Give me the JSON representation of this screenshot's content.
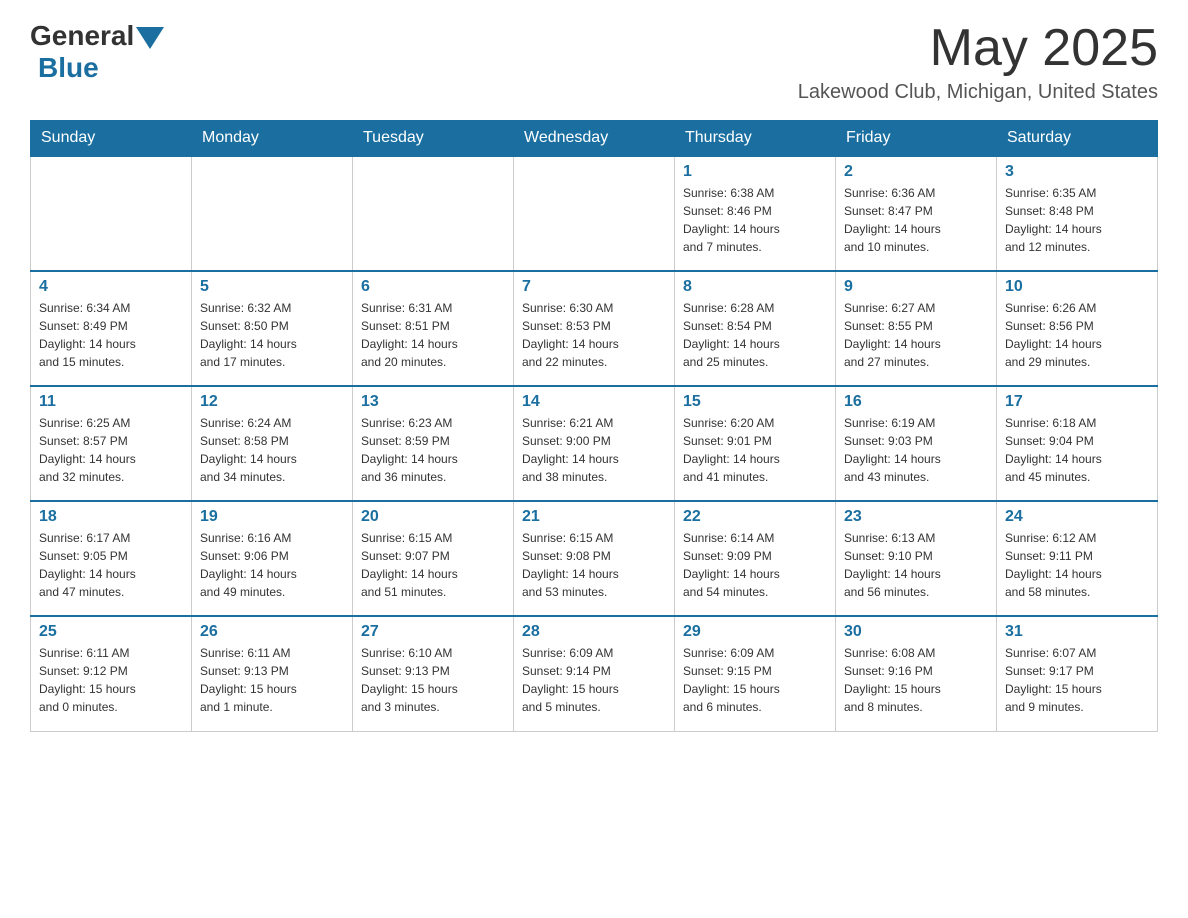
{
  "header": {
    "logo_general": "General",
    "logo_blue": "Blue",
    "month": "May 2025",
    "location": "Lakewood Club, Michigan, United States"
  },
  "days_of_week": [
    "Sunday",
    "Monday",
    "Tuesday",
    "Wednesday",
    "Thursday",
    "Friday",
    "Saturday"
  ],
  "weeks": [
    {
      "days": [
        {
          "number": "",
          "info": ""
        },
        {
          "number": "",
          "info": ""
        },
        {
          "number": "",
          "info": ""
        },
        {
          "number": "",
          "info": ""
        },
        {
          "number": "1",
          "info": "Sunrise: 6:38 AM\nSunset: 8:46 PM\nDaylight: 14 hours\nand 7 minutes."
        },
        {
          "number": "2",
          "info": "Sunrise: 6:36 AM\nSunset: 8:47 PM\nDaylight: 14 hours\nand 10 minutes."
        },
        {
          "number": "3",
          "info": "Sunrise: 6:35 AM\nSunset: 8:48 PM\nDaylight: 14 hours\nand 12 minutes."
        }
      ]
    },
    {
      "days": [
        {
          "number": "4",
          "info": "Sunrise: 6:34 AM\nSunset: 8:49 PM\nDaylight: 14 hours\nand 15 minutes."
        },
        {
          "number": "5",
          "info": "Sunrise: 6:32 AM\nSunset: 8:50 PM\nDaylight: 14 hours\nand 17 minutes."
        },
        {
          "number": "6",
          "info": "Sunrise: 6:31 AM\nSunset: 8:51 PM\nDaylight: 14 hours\nand 20 minutes."
        },
        {
          "number": "7",
          "info": "Sunrise: 6:30 AM\nSunset: 8:53 PM\nDaylight: 14 hours\nand 22 minutes."
        },
        {
          "number": "8",
          "info": "Sunrise: 6:28 AM\nSunset: 8:54 PM\nDaylight: 14 hours\nand 25 minutes."
        },
        {
          "number": "9",
          "info": "Sunrise: 6:27 AM\nSunset: 8:55 PM\nDaylight: 14 hours\nand 27 minutes."
        },
        {
          "number": "10",
          "info": "Sunrise: 6:26 AM\nSunset: 8:56 PM\nDaylight: 14 hours\nand 29 minutes."
        }
      ]
    },
    {
      "days": [
        {
          "number": "11",
          "info": "Sunrise: 6:25 AM\nSunset: 8:57 PM\nDaylight: 14 hours\nand 32 minutes."
        },
        {
          "number": "12",
          "info": "Sunrise: 6:24 AM\nSunset: 8:58 PM\nDaylight: 14 hours\nand 34 minutes."
        },
        {
          "number": "13",
          "info": "Sunrise: 6:23 AM\nSunset: 8:59 PM\nDaylight: 14 hours\nand 36 minutes."
        },
        {
          "number": "14",
          "info": "Sunrise: 6:21 AM\nSunset: 9:00 PM\nDaylight: 14 hours\nand 38 minutes."
        },
        {
          "number": "15",
          "info": "Sunrise: 6:20 AM\nSunset: 9:01 PM\nDaylight: 14 hours\nand 41 minutes."
        },
        {
          "number": "16",
          "info": "Sunrise: 6:19 AM\nSunset: 9:03 PM\nDaylight: 14 hours\nand 43 minutes."
        },
        {
          "number": "17",
          "info": "Sunrise: 6:18 AM\nSunset: 9:04 PM\nDaylight: 14 hours\nand 45 minutes."
        }
      ]
    },
    {
      "days": [
        {
          "number": "18",
          "info": "Sunrise: 6:17 AM\nSunset: 9:05 PM\nDaylight: 14 hours\nand 47 minutes."
        },
        {
          "number": "19",
          "info": "Sunrise: 6:16 AM\nSunset: 9:06 PM\nDaylight: 14 hours\nand 49 minutes."
        },
        {
          "number": "20",
          "info": "Sunrise: 6:15 AM\nSunset: 9:07 PM\nDaylight: 14 hours\nand 51 minutes."
        },
        {
          "number": "21",
          "info": "Sunrise: 6:15 AM\nSunset: 9:08 PM\nDaylight: 14 hours\nand 53 minutes."
        },
        {
          "number": "22",
          "info": "Sunrise: 6:14 AM\nSunset: 9:09 PM\nDaylight: 14 hours\nand 54 minutes."
        },
        {
          "number": "23",
          "info": "Sunrise: 6:13 AM\nSunset: 9:10 PM\nDaylight: 14 hours\nand 56 minutes."
        },
        {
          "number": "24",
          "info": "Sunrise: 6:12 AM\nSunset: 9:11 PM\nDaylight: 14 hours\nand 58 minutes."
        }
      ]
    },
    {
      "days": [
        {
          "number": "25",
          "info": "Sunrise: 6:11 AM\nSunset: 9:12 PM\nDaylight: 15 hours\nand 0 minutes."
        },
        {
          "number": "26",
          "info": "Sunrise: 6:11 AM\nSunset: 9:13 PM\nDaylight: 15 hours\nand 1 minute."
        },
        {
          "number": "27",
          "info": "Sunrise: 6:10 AM\nSunset: 9:13 PM\nDaylight: 15 hours\nand 3 minutes."
        },
        {
          "number": "28",
          "info": "Sunrise: 6:09 AM\nSunset: 9:14 PM\nDaylight: 15 hours\nand 5 minutes."
        },
        {
          "number": "29",
          "info": "Sunrise: 6:09 AM\nSunset: 9:15 PM\nDaylight: 15 hours\nand 6 minutes."
        },
        {
          "number": "30",
          "info": "Sunrise: 6:08 AM\nSunset: 9:16 PM\nDaylight: 15 hours\nand 8 minutes."
        },
        {
          "number": "31",
          "info": "Sunrise: 6:07 AM\nSunset: 9:17 PM\nDaylight: 15 hours\nand 9 minutes."
        }
      ]
    }
  ]
}
